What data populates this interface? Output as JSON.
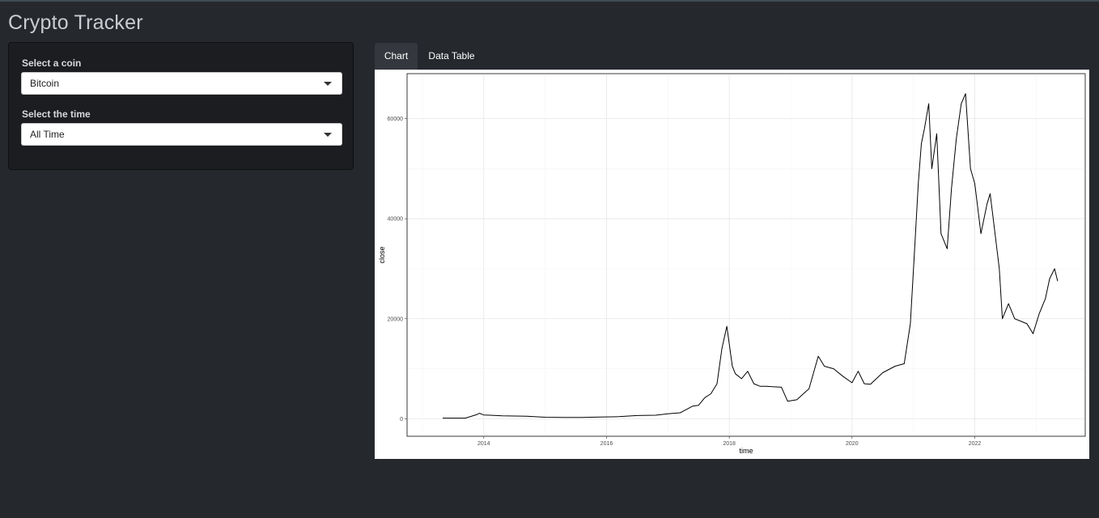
{
  "app": {
    "title": "Crypto Tracker"
  },
  "sidebar": {
    "coin": {
      "label": "Select a coin",
      "value": "Bitcoin"
    },
    "time": {
      "label": "Select the time",
      "value": "All Time"
    }
  },
  "tabs": [
    {
      "label": "Chart",
      "active": true
    },
    {
      "label": "Data Table",
      "active": false
    }
  ],
  "chart_data": {
    "type": "line",
    "xlabel": "time",
    "ylabel": "close",
    "x_ticks": [
      "2014",
      "2016",
      "2018",
      "2020",
      "2022"
    ],
    "y_ticks": [
      "0",
      "20000",
      "40000",
      "60000"
    ],
    "xlim": [
      2012.75,
      2023.8
    ],
    "ylim": [
      -3500,
      69000
    ],
    "grid": true,
    "line_color": "#000000",
    "x": [
      2013.33,
      2013.7,
      2013.88,
      2013.93,
      2014.0,
      2014.1,
      2014.3,
      2014.5,
      2014.7,
      2015.0,
      2015.3,
      2015.6,
      2015.9,
      2016.2,
      2016.5,
      2016.8,
      2017.0,
      2017.2,
      2017.4,
      2017.5,
      2017.6,
      2017.7,
      2017.8,
      2017.88,
      2017.96,
      2018.0,
      2018.05,
      2018.1,
      2018.2,
      2018.3,
      2018.4,
      2018.5,
      2018.6,
      2018.7,
      2018.85,
      2018.95,
      2019.1,
      2019.3,
      2019.45,
      2019.55,
      2019.7,
      2019.85,
      2020.0,
      2020.1,
      2020.2,
      2020.3,
      2020.5,
      2020.7,
      2020.85,
      2020.95,
      2021.02,
      2021.08,
      2021.13,
      2021.18,
      2021.25,
      2021.3,
      2021.38,
      2021.45,
      2021.55,
      2021.62,
      2021.7,
      2021.78,
      2021.85,
      2021.93,
      2022.0,
      2022.1,
      2022.2,
      2022.25,
      2022.32,
      2022.4,
      2022.45,
      2022.55,
      2022.65,
      2022.75,
      2022.85,
      2022.95,
      2023.05,
      2023.15,
      2023.22,
      2023.3,
      2023.35
    ],
    "y": [
      120,
      130,
      800,
      1100,
      750,
      700,
      600,
      550,
      500,
      300,
      250,
      250,
      350,
      420,
      650,
      700,
      1000,
      1200,
      2500,
      2700,
      4200,
      5000,
      7000,
      14000,
      18500,
      15000,
      10500,
      9000,
      8000,
      9500,
      7000,
      6500,
      6500,
      6400,
      6300,
      3500,
      3800,
      6000,
      12500,
      10500,
      10000,
      8500,
      7200,
      9500,
      7000,
      6900,
      9200,
      10500,
      11000,
      19000,
      34000,
      47000,
      55000,
      58000,
      63000,
      50000,
      57000,
      37000,
      34000,
      46000,
      56000,
      63000,
      65000,
      50000,
      47000,
      37000,
      43000,
      45000,
      38000,
      30000,
      20000,
      23000,
      20000,
      19500,
      19000,
      17000,
      21000,
      24000,
      28000,
      30000,
      27500
    ]
  }
}
